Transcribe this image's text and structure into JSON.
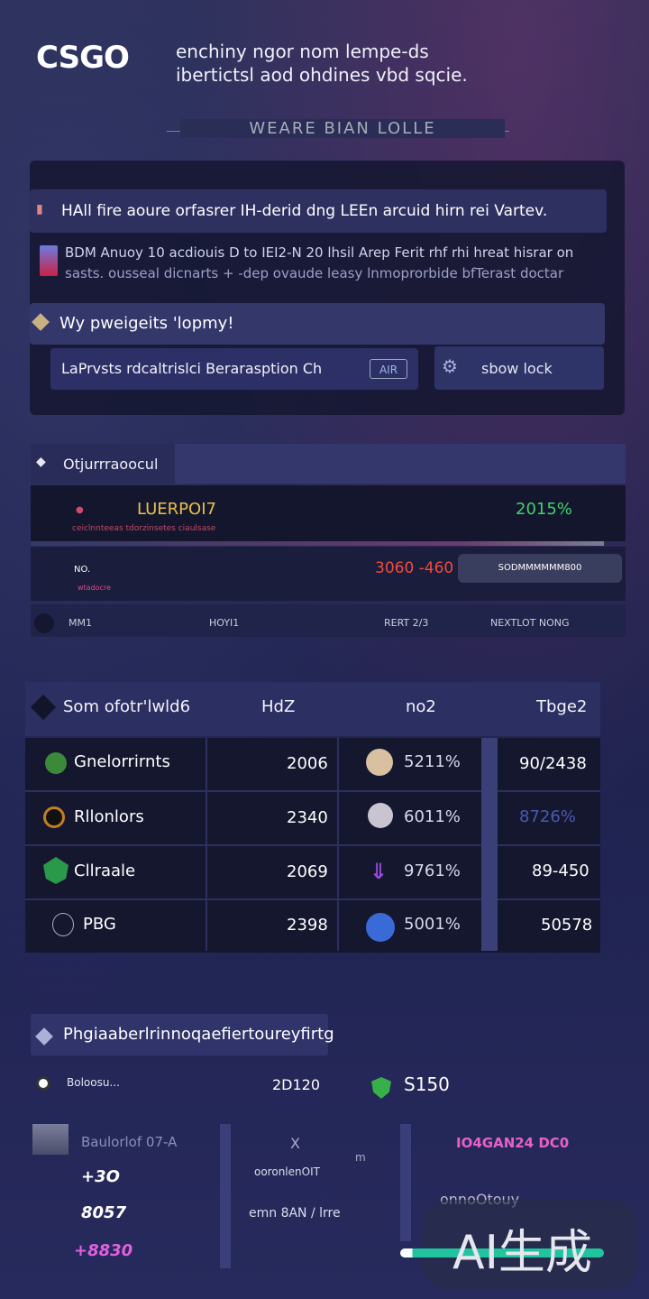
{
  "header": {
    "logo": "CSGO",
    "tagline_1": "enchiny ngor nom lempe-ds",
    "tagline_2": "ibertictsl aod ohdines vbd sqcie.",
    "divider": "WEARE BIAN LOLLE"
  },
  "alert": {
    "text": "HAll fire aoure orfasrer IH-derid dng LEEn arcuid hirn rei Vartev."
  },
  "news": {
    "line1": "BDM Anuoy 10 acdiouis   D to IEI2-N 20 lhsil Arep Ferit rhf rhi hreat hisrar on",
    "line2": "sasts. ousseal dicnarts  + -dep ovaude leasy lnmoprorbide bfTerast doctar"
  },
  "section1": {
    "title": "Wy pweigeits 'lopmy!"
  },
  "search": {
    "value": "LaPrvsts rdcaltrislci Berarasption Ch",
    "badge": "AIR"
  },
  "button": {
    "label": "sbow lock"
  },
  "matches": {
    "tab_label": "Otjurrraoocul",
    "row1": {
      "name": "LUERPOI7",
      "subtitle": "ceiclnnteeas tdorzinsetes  ciaulsase",
      "pct": "2015%"
    },
    "row2": {
      "a": "NO.",
      "b": "wtadocre",
      "score": "3060 -460",
      "pill": "SODMMMMMM800"
    },
    "cols": [
      "MM1",
      "HOYI1",
      "RERT 2/3",
      "NEXTLOT NONG"
    ]
  },
  "table": {
    "headers": [
      "Som ofotr'lwld6",
      "HdZ",
      "no2",
      "Tbge2"
    ],
    "rows": [
      {
        "team": "Gnelorrirnts",
        "value": "2006",
        "pct": "5211%",
        "last": "90/2438",
        "last_color": "#ffffff",
        "icon_color": "#3a8a3a"
      },
      {
        "team": "Rllonlors",
        "value": "2340",
        "pct": "6011%",
        "last": "8726%",
        "last_color": "#4a5ab0",
        "icon_color": "#c08020"
      },
      {
        "team": "Cllraale",
        "value": "2069",
        "pct": "9761%",
        "last": "89-450",
        "last_color": "#ffffff",
        "icon_color": "#2a9a4a"
      },
      {
        "team": "PBG",
        "value": "2398",
        "pct": "5001%",
        "last": "50578",
        "last_color": "#ffffff",
        "icon_color": "#3a6ad8"
      }
    ]
  },
  "section3": {
    "title": "Phgiaaberlrinnoqaefiertoureyfirtg",
    "label": "Boloosu...",
    "val": "2D120",
    "val2": "S150"
  },
  "bottom": {
    "colA_label": "Baulorlof 07-A",
    "colA_vals": [
      "+3O",
      "8057",
      "+8830"
    ],
    "colB_top": "X",
    "colB_m": "m",
    "colB_l1": "ooronlenOIT",
    "colB_l2": "emn 8AN / lrre",
    "colC_top": "IO4GAN24 DC0",
    "colC_mid": "onnoOtouy",
    "progress": 0.06
  },
  "watermark": "AI生成"
}
